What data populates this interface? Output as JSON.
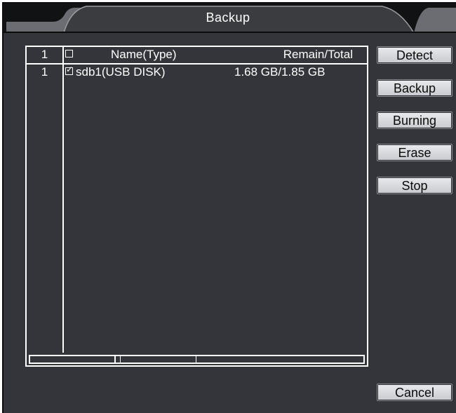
{
  "window": {
    "title": "Backup"
  },
  "list": {
    "header": {
      "index": "1",
      "name": "Name(Type)",
      "remain": "Remain/Total"
    },
    "rows": [
      {
        "index": "1",
        "checked": true,
        "name": "sdb1(USB DISK)",
        "remain": "1.68 GB/1.85 GB"
      }
    ],
    "check_mark": "☑"
  },
  "buttons": {
    "detect": "Detect",
    "backup": "Backup",
    "burning": "Burning",
    "erase": "Erase",
    "stop": "Stop",
    "cancel": "Cancel"
  }
}
